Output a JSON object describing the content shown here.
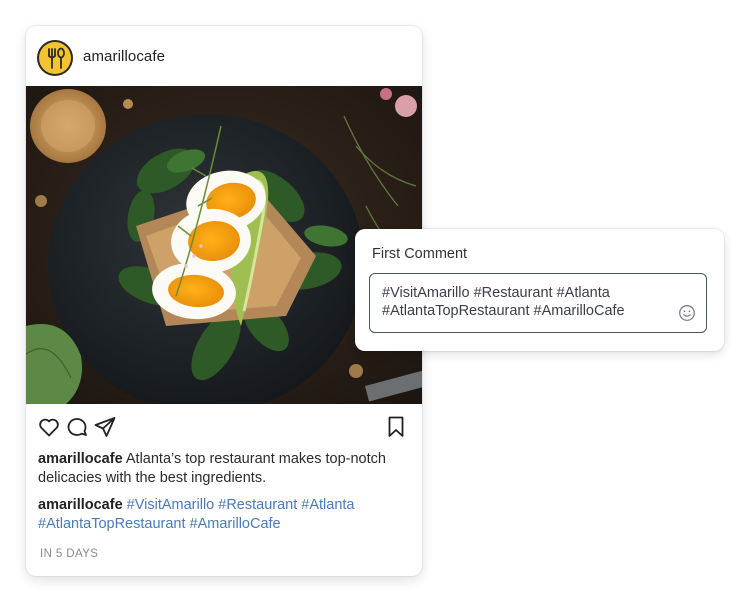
{
  "post": {
    "username": "amarillocafe",
    "image_alt": "Open-faced sandwich with halved boiled eggs, avocado and spinach on a dark plate",
    "actions": {
      "like_icon": "heart-icon",
      "comment_icon": "comment-icon",
      "share_icon": "paper-plane-icon",
      "save_icon": "bookmark-icon"
    },
    "caption": {
      "author": "amarillocafe",
      "text": "Atlanta’s top restaurant makes top-notch delicacies with the best ingredients."
    },
    "first_comment_preview": {
      "author": "amarillocafe",
      "tags": "#VisitAmarillo #Restaurant #Atlanta #AtlantaTopRestaurant #AmarilloCafe"
    },
    "timestamp": "IN 5 DAYS"
  },
  "first_comment": {
    "title": "First Comment",
    "value": "#VisitAmarillo #Restaurant #Atlanta #AtlantaTopRestaurant #AmarilloCafe",
    "emoji_icon": "smiley-icon"
  },
  "colors": {
    "hashtag": "#4a7ab8",
    "avatar_bg": "#f4c430",
    "border": "#4c5563"
  }
}
